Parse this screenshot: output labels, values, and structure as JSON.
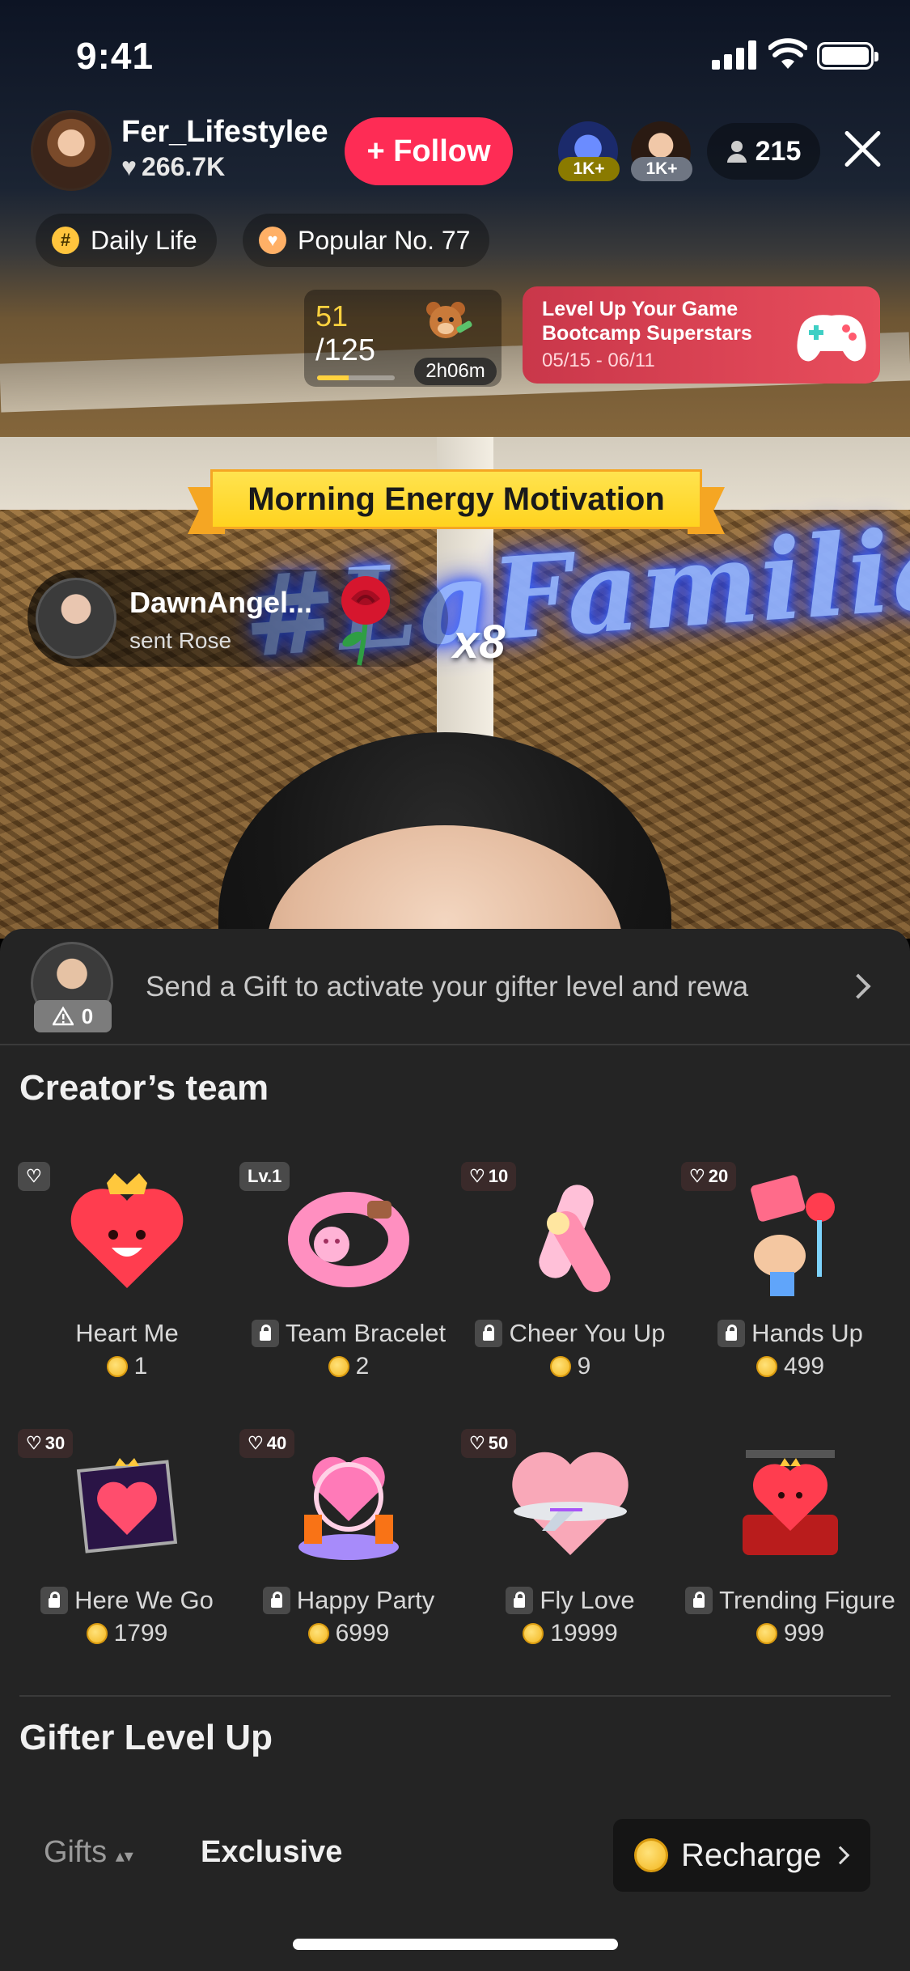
{
  "status_bar": {
    "time": "9:41"
  },
  "host": {
    "name": "Fer_Lifestylee",
    "likes": "266.7K",
    "follow_label": "+ Follow"
  },
  "viewers": {
    "top1_badge": "1K+",
    "top2_badge": "1K+",
    "count": "215"
  },
  "tags": [
    {
      "icon": "hashtag-icon",
      "label": "Daily Life"
    },
    {
      "icon": "heart-icon",
      "label": "Popular No. 77"
    }
  ],
  "progress": {
    "current": "51",
    "goal": "/125",
    "fraction": 0.408,
    "timer": "2h06m"
  },
  "promo": {
    "line1": "Level Up Your Game",
    "line2": "Bootcamp Superstars",
    "dates": "05/15 - 06/11"
  },
  "banner": {
    "text": "Morning Energy Motivation"
  },
  "neon_sign": "#LaFamilia",
  "gift_notification": {
    "user": "DawnAngel...",
    "action": "sent Rose",
    "combo": "x8"
  },
  "gifter": {
    "level": "0",
    "prompt": "Send a Gift to activate your gifter level and rewa"
  },
  "creators_team": {
    "title": "Creator’s team",
    "gifts": [
      {
        "name": "Heart Me",
        "price": "1",
        "badge": "",
        "locked": false
      },
      {
        "name": "Team Bracelet",
        "price": "2",
        "badge": "Lv.1",
        "locked": true
      },
      {
        "name": "Cheer You Up",
        "price": "9",
        "badge": "10",
        "locked": true
      },
      {
        "name": "Hands Up",
        "price": "499",
        "badge": "20",
        "locked": true
      },
      {
        "name": "Here We Go",
        "price": "1799",
        "badge": "30",
        "locked": true
      },
      {
        "name": "Happy Party",
        "price": "6999",
        "badge": "40",
        "locked": true
      },
      {
        "name": "Fly Love",
        "price": "19999",
        "badge": "50",
        "locked": true
      },
      {
        "name": "Trending Figure",
        "price": "999",
        "badge": "",
        "locked": true
      }
    ]
  },
  "gifter_level_up": {
    "title": "Gifter Level Up"
  },
  "bottom_tabs": {
    "gifts": "Gifts",
    "exclusive": "Exclusive",
    "recharge": "Recharge"
  },
  "colors": {
    "follow": "#fe2c55",
    "panel": "#242424",
    "coin": "#f3b61f",
    "banner": "#ffd31f"
  }
}
